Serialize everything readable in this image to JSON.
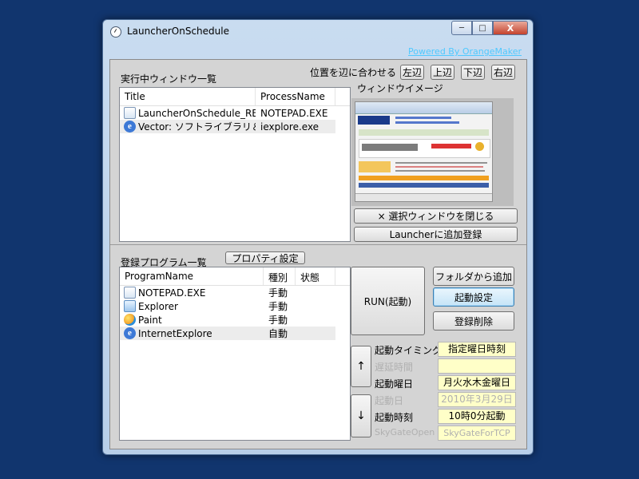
{
  "window": {
    "title": "LauncherOnSchedule",
    "powered_by": "Powered By OrangeMaker"
  },
  "caption": {
    "minimize": "─",
    "maximize": "□",
    "close": "X"
  },
  "running": {
    "title": "実行中ウィンドウ一覧",
    "align_label": "位置を辺に合わせる",
    "align_buttons": [
      "左辺",
      "上辺",
      "下辺",
      "右辺"
    ],
    "preview_label": "ウィンドウイメージ",
    "columns": [
      "Title",
      "ProcessName"
    ],
    "rows": [
      {
        "icon": "document-icon",
        "title": "LauncherOnSchedule_REA...",
        "process": "NOTEPAD.EXE"
      },
      {
        "icon": "ie-icon",
        "title": "Vector: ソフトライブラリ＆...",
        "process": "iexplore.exe"
      }
    ],
    "close_button": "× 選択ウィンドウを閉じる",
    "add_button": "Launcherに追加登録"
  },
  "programs": {
    "title": "登録プログラム一覧",
    "property_button": "プロパティ設定",
    "columns": [
      "ProgramName",
      "種別",
      "状態"
    ],
    "rows": [
      {
        "icon": "document-icon",
        "name": "NOTEPAD.EXE",
        "kind": "手動",
        "state": ""
      },
      {
        "icon": "folder-icon",
        "name": "Explorer",
        "kind": "手動",
        "state": ""
      },
      {
        "icon": "paint-icon",
        "name": "Paint",
        "kind": "手動",
        "state": ""
      },
      {
        "icon": "ie-icon",
        "name": "InternetExplore",
        "kind": "自動",
        "state": ""
      }
    ],
    "run_button": "RUN(起動)",
    "folder_button": "フォルダから追加",
    "launch_settings_button": "起動設定",
    "delete_button": "登録削除",
    "up_button": "↑",
    "down_button": "↓"
  },
  "schedule": {
    "timing_label": "起動タイミング",
    "timing_value": "指定曜日時刻",
    "delay_label": "遅延時間",
    "delay_value": "",
    "weekday_label": "起動曜日",
    "weekday_value": "月火水木金曜日",
    "date_label": "起動日",
    "date_value": "2010年3月29日",
    "time_label": "起動時刻",
    "time_value": "10時0分起動",
    "skygate_label": "SkyGateOpen",
    "skygate_value": "SkyGateForTCP"
  },
  "colors": {
    "desktop": "#11356e",
    "link": "#4fc9ff",
    "field_bg": "#ffffc8"
  }
}
